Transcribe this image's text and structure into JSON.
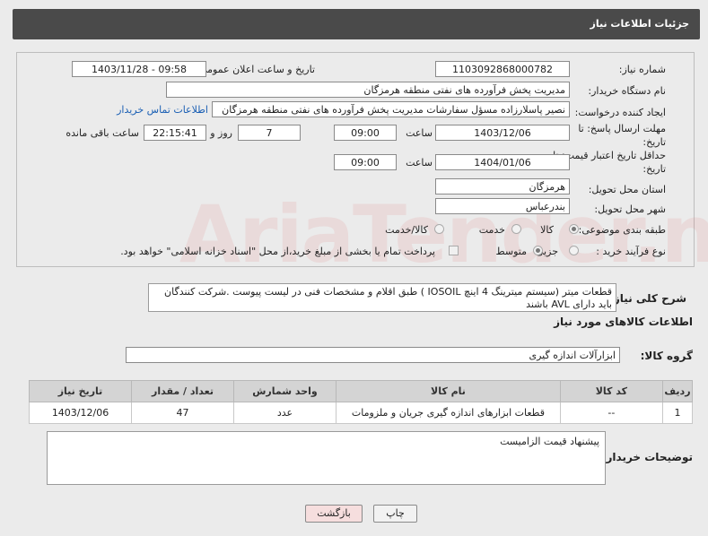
{
  "header": {
    "title": "جزئیات اطلاعات نیاز"
  },
  "form": {
    "need_number_label": "شماره نیاز:",
    "need_number": "1103092868000782",
    "announce_label": "تاریخ و ساعت اعلان عمومی:",
    "announce_value": "1403/11/28 - 09:58",
    "buyer_org_label": "نام دستگاه خریدار:",
    "buyer_org": "مدیریت پخش فرآورده های نفتی منطقه هرمزگان",
    "requester_label": "ایجاد کننده درخواست:",
    "requester": "نصیر پاسلارزاده مسؤل سفارشات مدیریت پخش فرآورده های نفتی منطقه هرمزگان",
    "contact_link": "اطلاعات تماس خریدار",
    "deadline_label_1": "مهلت ارسال پاسخ: تا",
    "deadline_label_2": "تاریخ:",
    "deadline_date": "1403/12/06",
    "time_label": "ساعت",
    "deadline_time": "09:00",
    "days_value": "7",
    "days_label": "روز و",
    "remaining_time": "22:15:41",
    "remaining_label": "ساعت باقی مانده",
    "price_valid_label_1": "حداقل تاریخ اعتبار قیمت: تا",
    "price_valid_label_2": "تاریخ:",
    "price_valid_date": "1404/01/06",
    "price_valid_time": "09:00",
    "province_label": "استان محل تحویل:",
    "province": "هرمزگان",
    "city_label": "شهر محل تحویل:",
    "city": "بندرعباس",
    "category_label": "طبقه بندی موضوعی:",
    "category_options": [
      "کالا",
      "خدمت",
      "کالا/خدمت"
    ],
    "purchase_label": "نوع فرآیند خرید :",
    "purchase_options": [
      "جزیی",
      "متوسط"
    ],
    "payment_note": "پرداخت تمام یا بخشی از مبلغ خرید،از محل \"اسناد خزانه اسلامی\" خواهد بود."
  },
  "description": {
    "label": "شرح کلی نیاز:",
    "text": "قطعات میتر (سیستم میترینگ 4 اینچ  IOSOIL ) طبق اقلام و مشخصات فنی در لیست پیوست .شرکت کنندگان باید دارای AVL باشند"
  },
  "goods_info_title": "اطلاعات کالاهای مورد نیاز",
  "goods_group_label": "گروه کالا:",
  "goods_group": "ابزارآلات اندازه گیری",
  "table": {
    "headers": [
      "ردیف",
      "کد کالا",
      "نام کالا",
      "واحد شمارش",
      "تعداد / مقدار",
      "تاریخ نیاز"
    ],
    "rows": [
      [
        "1",
        "--",
        "قطعات ابزارهای اندازه گیری جریان و ملزومات",
        "عدد",
        "47",
        "1403/12/06"
      ]
    ]
  },
  "buyer_notes_label": "توضیحات خریدار:",
  "buyer_notes": "پیشنهاد قیمت الزامیست",
  "buttons": {
    "print": "چاپ",
    "back": "بازگشت"
  },
  "colors": {
    "header_bg": "#4a4a4a",
    "link": "#1a5fb4",
    "back_button_bg": "#f6dede"
  }
}
